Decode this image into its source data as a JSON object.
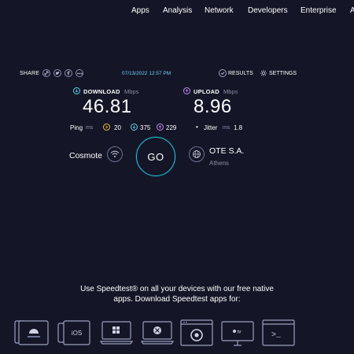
{
  "nav": {
    "items": [
      "Apps",
      "Analysis",
      "Network",
      "Developers",
      "Enterprise",
      "A"
    ]
  },
  "share": {
    "label": "SHARE",
    "icons": [
      "link-icon",
      "twitter-icon",
      "facebook-icon",
      "more-icon"
    ]
  },
  "test": {
    "datetime": "07/13/2022 12:57 PM",
    "results_label": "RESULTS",
    "settings_label": "SETTINGS"
  },
  "download": {
    "label": "DOWNLOAD",
    "unit": "Mbps",
    "value": "46.81"
  },
  "upload": {
    "label": "UPLOAD",
    "unit": "Mbps",
    "value": "8.96"
  },
  "ping": {
    "label": "Ping",
    "unit": "ms",
    "idle": "20",
    "download": "375",
    "upload": "229"
  },
  "jitter": {
    "label": "Jitter",
    "unit": "ms",
    "value": "1.8"
  },
  "isp": {
    "name": "Cosmote"
  },
  "go_button": {
    "label": "GO"
  },
  "server": {
    "name": "OTE S.A.",
    "city": "Athens"
  },
  "promo": {
    "line1": "Use Speedtest® on all your devices with our free native",
    "line2": "apps. Download Speedtest apps for:"
  },
  "devices": [
    {
      "name": "android",
      "label": ""
    },
    {
      "name": "ios",
      "label": "iOS"
    },
    {
      "name": "windows",
      "label": ""
    },
    {
      "name": "mac",
      "label": ""
    },
    {
      "name": "chrome",
      "label": ""
    },
    {
      "name": "appletv",
      "label": "tv"
    },
    {
      "name": "cli",
      "label": ">_"
    }
  ],
  "colors": {
    "background": "#141526",
    "download_accent": "#5fd3f0",
    "upload_accent": "#c08ef0",
    "go_ring": "#22c0d8",
    "date_text": "#6fd0f2"
  }
}
